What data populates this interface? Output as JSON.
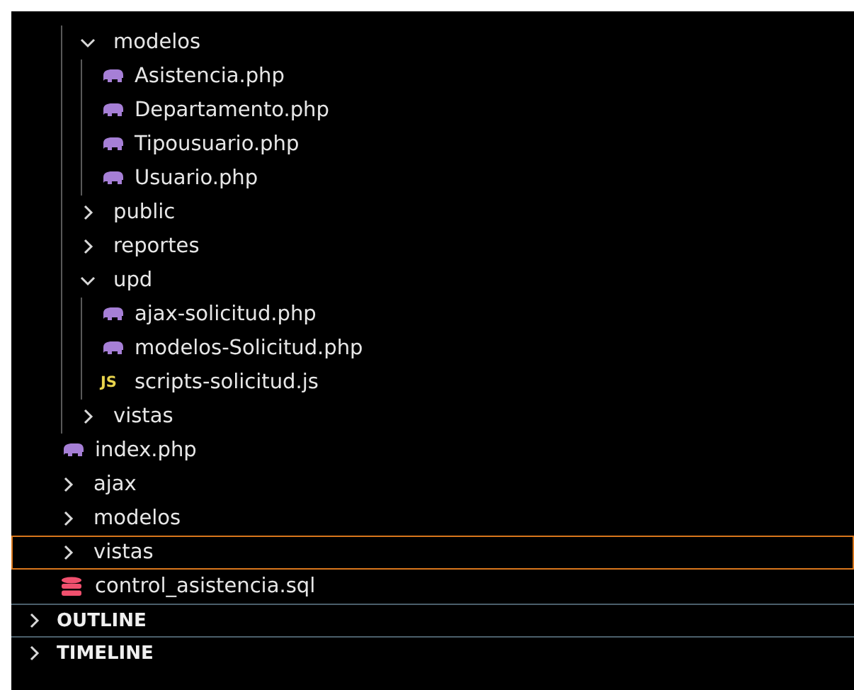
{
  "tree": [
    {
      "kind": "folder",
      "children": [
        {
          "kind": "folder",
          "label": "modelos",
          "expanded": true,
          "children": [
            {
              "kind": "php",
              "label": "Asistencia.php"
            },
            {
              "kind": "php",
              "label": "Departamento.php"
            },
            {
              "kind": "php",
              "label": "Tipousuario.php"
            },
            {
              "kind": "php",
              "label": "Usuario.php"
            }
          ]
        },
        {
          "kind": "folder",
          "label": "public",
          "expanded": false
        },
        {
          "kind": "folder",
          "label": "reportes",
          "expanded": false
        },
        {
          "kind": "folder",
          "label": "upd",
          "expanded": true,
          "children": [
            {
              "kind": "php",
              "label": "ajax-solicitud.php"
            },
            {
              "kind": "php",
              "label": "modelos-Solicitud.php"
            },
            {
              "kind": "js",
              "label": "scripts-solicitud.js",
              "icon_label": "JS"
            }
          ]
        },
        {
          "kind": "folder",
          "label": "vistas",
          "expanded": false
        }
      ]
    },
    {
      "kind": "php",
      "label": "index.php"
    },
    {
      "kind": "folder",
      "label": "ajax",
      "expanded": false
    },
    {
      "kind": "folder",
      "label": "modelos",
      "expanded": false
    },
    {
      "kind": "folder",
      "label": "vistas",
      "expanded": false,
      "focused": true
    },
    {
      "kind": "sql",
      "label": "control_asistencia.sql"
    }
  ],
  "sections": [
    {
      "label": "OUTLINE",
      "expanded": false
    },
    {
      "label": "TIMELINE",
      "expanded": false
    }
  ]
}
